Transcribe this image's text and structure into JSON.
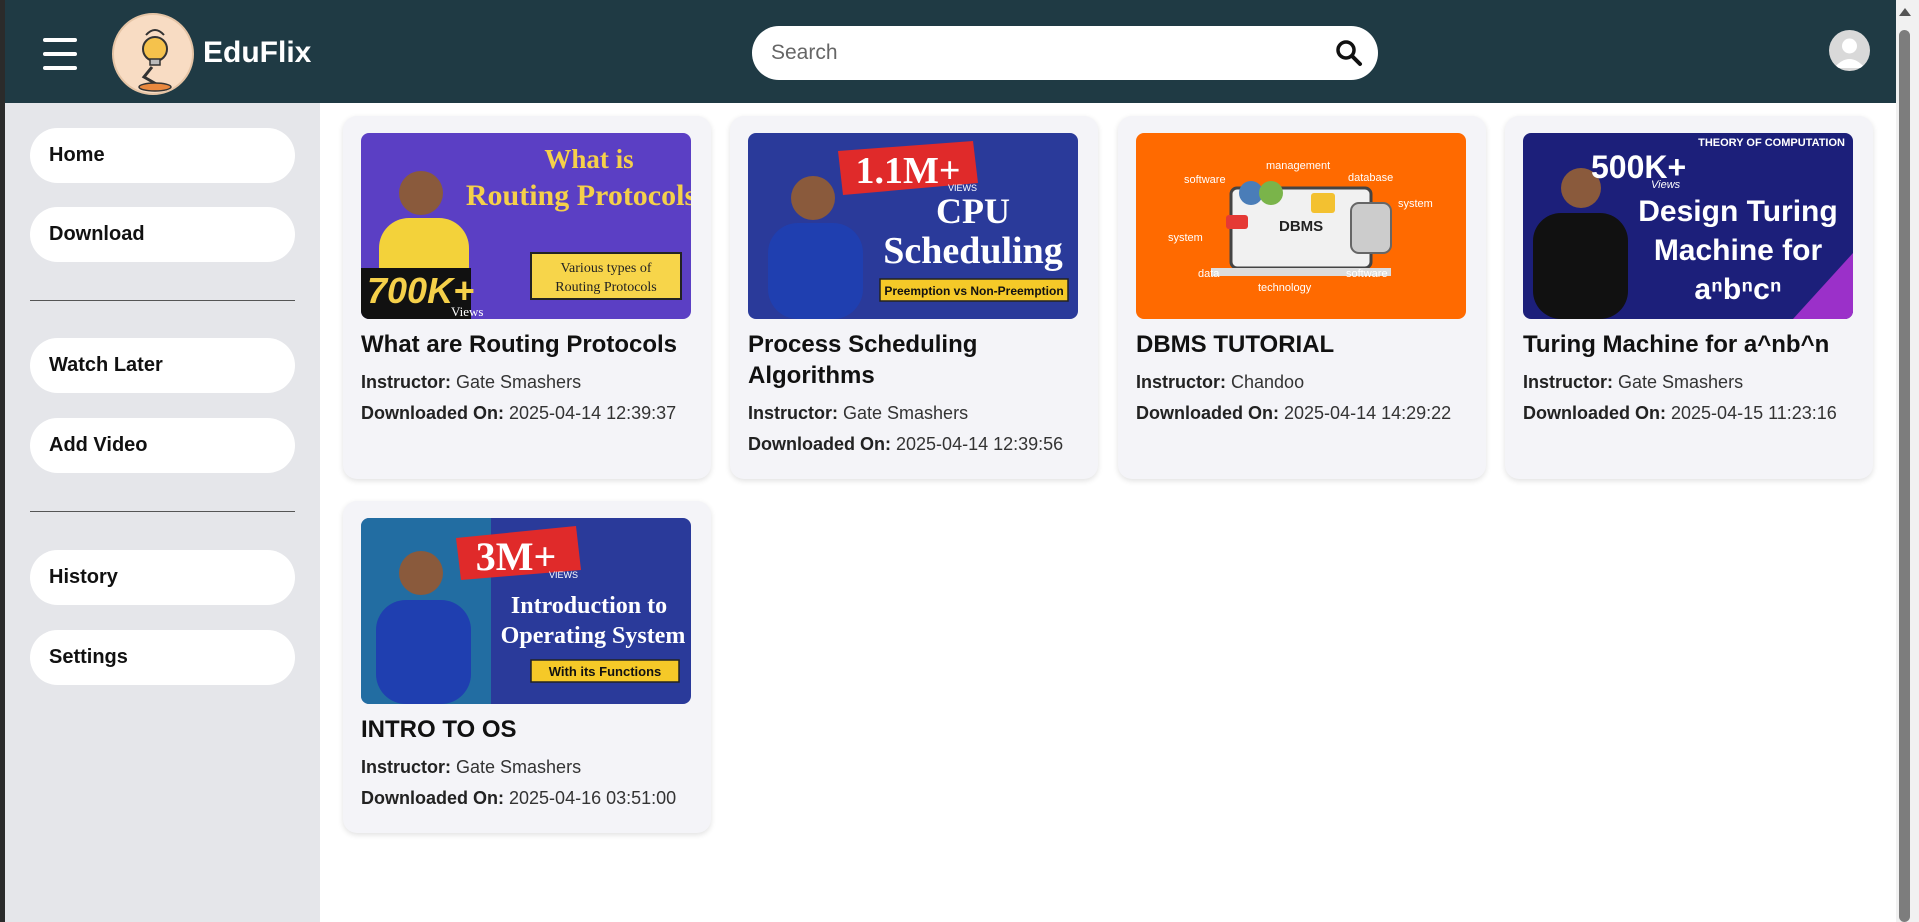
{
  "header": {
    "brand": "EduFlix",
    "search_placeholder": "Search"
  },
  "sidebar": {
    "items": [
      {
        "label": "Home"
      },
      {
        "label": "Download"
      },
      {
        "label": "Watch Later"
      },
      {
        "label": "Add Video"
      },
      {
        "label": "History"
      },
      {
        "label": "Settings"
      }
    ]
  },
  "labels": {
    "instructor": "Instructor:",
    "downloaded_on": "Downloaded On:"
  },
  "videos": [
    {
      "title": "What are Routing Protocols",
      "instructor": "Gate Smashers",
      "downloaded_on": "2025-04-14 12:39:37",
      "thumb_text": [
        "What is",
        "Routing Protocols",
        "Various types of",
        "Routing Protocols",
        "700K+",
        "Views"
      ]
    },
    {
      "title": "Process Scheduling Algorithms",
      "instructor": "Gate Smashers",
      "downloaded_on": "2025-04-14 12:39:56",
      "thumb_text": [
        "1.1M+",
        "VIEWS",
        "CPU",
        "Scheduling",
        "Preemption vs Non-Preemption"
      ]
    },
    {
      "title": "DBMS TUTORIAL",
      "instructor": "Chandoo",
      "downloaded_on": "2025-04-14 14:29:22",
      "thumb_text": [
        "management",
        "software",
        "database",
        "system",
        "system",
        "DBMS",
        "data",
        "technology",
        "software"
      ]
    },
    {
      "title": "Turing Machine for a^nb^n",
      "instructor": "Gate Smashers",
      "downloaded_on": "2025-04-15 11:23:16",
      "thumb_text": [
        "THEORY OF COMPUTATION",
        "500K+",
        "Views",
        "Design Turing",
        "Machine for",
        "aⁿbⁿcⁿ"
      ]
    },
    {
      "title": "INTRO TO OS",
      "instructor": "Gate Smashers",
      "downloaded_on": "2025-04-16 03:51:00",
      "thumb_text": [
        "3M+",
        "VIEWS",
        "Introduction to",
        "Operating System",
        "With its Functions"
      ]
    }
  ],
  "colors": {
    "header_bg": "#1f3a44",
    "sidebar_bg": "#e5e6ea",
    "card_bg": "#f4f4f8"
  }
}
